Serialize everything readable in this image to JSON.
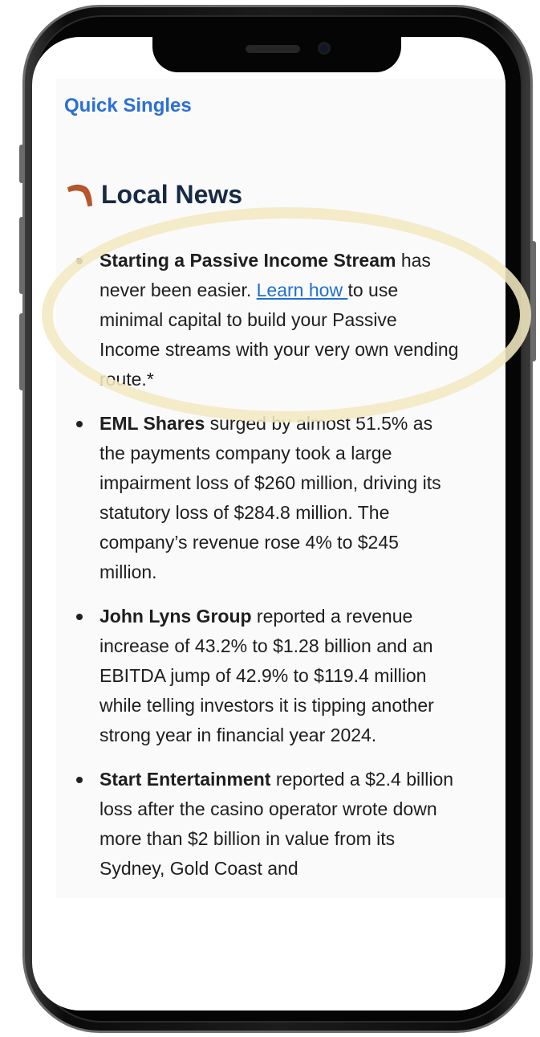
{
  "page": {
    "quick_link": "Quick Singles",
    "section_title": "Local News"
  },
  "icons": {
    "section_icon": "boomerang-icon"
  },
  "news": [
    {
      "headline": "Starting a Passive Income Stream",
      "text_before": " has never been easier. ",
      "link": "Learn how ",
      "text_after": "to use minimal capital to build your Passive Income streams with your very own vending route.*"
    },
    {
      "headline": "EML Shares",
      "text_before": " surged by almost 51.5% as the payments company took a large impairment loss of $260 million, driving its statutory loss of $284.8 million. The company’s revenue rose 4% to $245 million."
    },
    {
      "headline": "John Lyns Group",
      "text_before": " reported a revenue increase of 43.2% to $1.28 billion and an EBITDA jump of 42.9% to $119.4 million while telling investors it is tipping another strong year in financial year 2024."
    },
    {
      "headline": "Start Entertainment",
      "text_before": " reported a $2.4 billion loss after the casino operator wrote down more than $2 billion in value from its Sydney, Gold Coast and"
    }
  ],
  "colors": {
    "link": "#2a6fd6",
    "title": "#162a44",
    "highlight": "#f3e8c0"
  }
}
